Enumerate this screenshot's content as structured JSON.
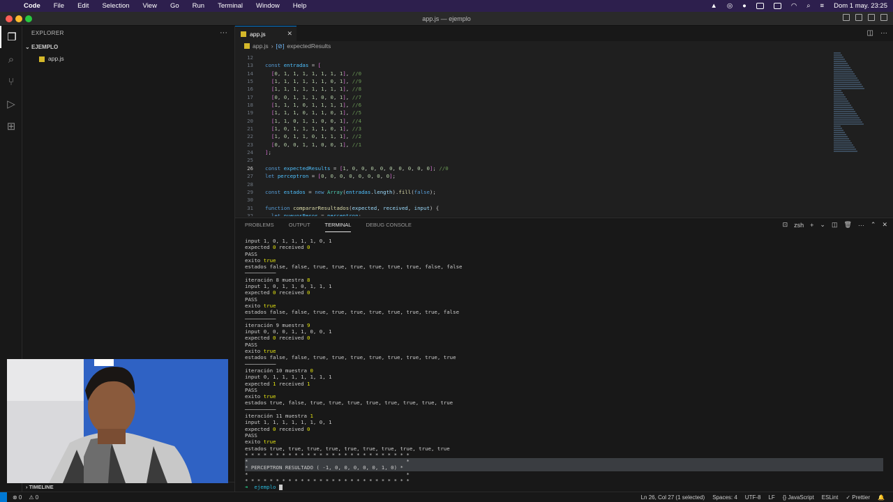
{
  "menubar": {
    "app_name": "Code",
    "items": [
      "File",
      "Edit",
      "Selection",
      "View",
      "Go",
      "Run",
      "Terminal",
      "Window",
      "Help"
    ],
    "clock": "Dom 1 may.  23:25"
  },
  "window": {
    "title": "app.js — ejemplo"
  },
  "sidebar": {
    "header": "EXPLORER",
    "folder": "EJEMPLO",
    "files": [
      "app.js"
    ],
    "timeline": "TIMELINE"
  },
  "editor": {
    "tab_label": "app.js",
    "breadcrumb": [
      "app.js",
      "expectedResults"
    ],
    "current_line": 26,
    "lines": [
      {
        "n": 12,
        "t": ""
      },
      {
        "n": 13,
        "t": "const entradas = ["
      },
      {
        "n": 14,
        "t": "  [0, 1, 1, 1, 1, 1, 1, 1], //0"
      },
      {
        "n": 15,
        "t": "  [1, 1, 1, 1, 1, 1, 0, 1], //9"
      },
      {
        "n": 16,
        "t": "  [1, 1, 1, 1, 1, 1, 1, 1], //8"
      },
      {
        "n": 17,
        "t": "  [0, 0, 1, 1, 1, 0, 0, 1], //7"
      },
      {
        "n": 18,
        "t": "  [1, 1, 1, 0, 1, 1, 1, 1], //6"
      },
      {
        "n": 19,
        "t": "  [1, 1, 1, 0, 1, 1, 0, 1], //5"
      },
      {
        "n": 20,
        "t": "  [1, 1, 0, 1, 1, 0, 0, 1], //4"
      },
      {
        "n": 21,
        "t": "  [1, 0, 1, 1, 1, 1, 0, 1], //3"
      },
      {
        "n": 22,
        "t": "  [1, 0, 1, 1, 0, 1, 1, 1], //2"
      },
      {
        "n": 23,
        "t": "  [0, 0, 0, 1, 1, 0, 0, 1], //1"
      },
      {
        "n": 24,
        "t": "];"
      },
      {
        "n": 25,
        "t": ""
      },
      {
        "n": 26,
        "t": "const expectedResults = [1, 0, 0, 0, 0, 0, 0, 0, 0, 0]; //0"
      },
      {
        "n": 27,
        "t": "let perceptron = [0, 0, 0, 0, 0, 0, 0, 0];"
      },
      {
        "n": 28,
        "t": ""
      },
      {
        "n": 29,
        "t": "const estados = new Array(entradas.length).fill(false);"
      },
      {
        "n": 30,
        "t": ""
      },
      {
        "n": 31,
        "t": "function compararResultados(expected, received, input) {"
      },
      {
        "n": 32,
        "t": "  let nuevosPesos = perceptron;"
      }
    ]
  },
  "panel": {
    "tabs": [
      "PROBLEMS",
      "OUTPUT",
      "TERMINAL",
      "DEBUG CONSOLE"
    ],
    "active_tab": "TERMINAL",
    "shell": "zsh",
    "terminal": [
      "input 1, 0, 1, 1, 1, 1, 0, 1",
      "expected 0 received 0",
      "PASS",
      "exito true",
      "estados false, false, true, true, true, true, true, true, false, false",
      "──────────",
      "iteración 8 muestra 8",
      "input 1, 0, 1, 1, 0, 1, 1, 1",
      "expected 0 received 0",
      "PASS",
      "exito true",
      "estados false, false, true, true, true, true, true, true, true, false",
      "──────────",
      "iteración 9 muestra 9",
      "input 0, 0, 0, 1, 1, 0, 0, 1",
      "expected 0 received 0",
      "PASS",
      "exito true",
      "estados false, false, true, true, true, true, true, true, true, true",
      "──────────",
      "iteración 10 muestra 0",
      "input 0, 1, 1, 1, 1, 1, 1, 1",
      "expected 1 received 1",
      "PASS",
      "exito true",
      "estados true, false, true, true, true, true, true, true, true, true",
      "──────────",
      "iteración 11 muestra 1",
      "input 1, 1, 1, 1, 1, 1, 0, 1",
      "expected 0 received 0",
      "PASS",
      "exito true",
      "estados true, true, true, true, true, true, true, true, true, true",
      "* * * * * * * * * * * * * * * * * * * * * * * * * * *",
      "*                                                   *",
      "* PERCEPTRON RESULTADO ( -1, 0, 0, 0, 0, 0, 1, 0) *",
      "*                                                   *",
      "* * * * * * * * * * * * * * * * * * * * * * * * * * *"
    ],
    "prompt": "➜  ejemplo"
  },
  "statusbar": {
    "errors": "⊗ 0",
    "warnings": "⚠ 0",
    "position": "Ln 26, Col 27 (1 selected)",
    "spaces": "Spaces: 4",
    "encoding": "UTF-8",
    "eol": "LF",
    "language": "{} JavaScript",
    "eslint": "ESLint",
    "prettier": "✓ Prettier"
  }
}
